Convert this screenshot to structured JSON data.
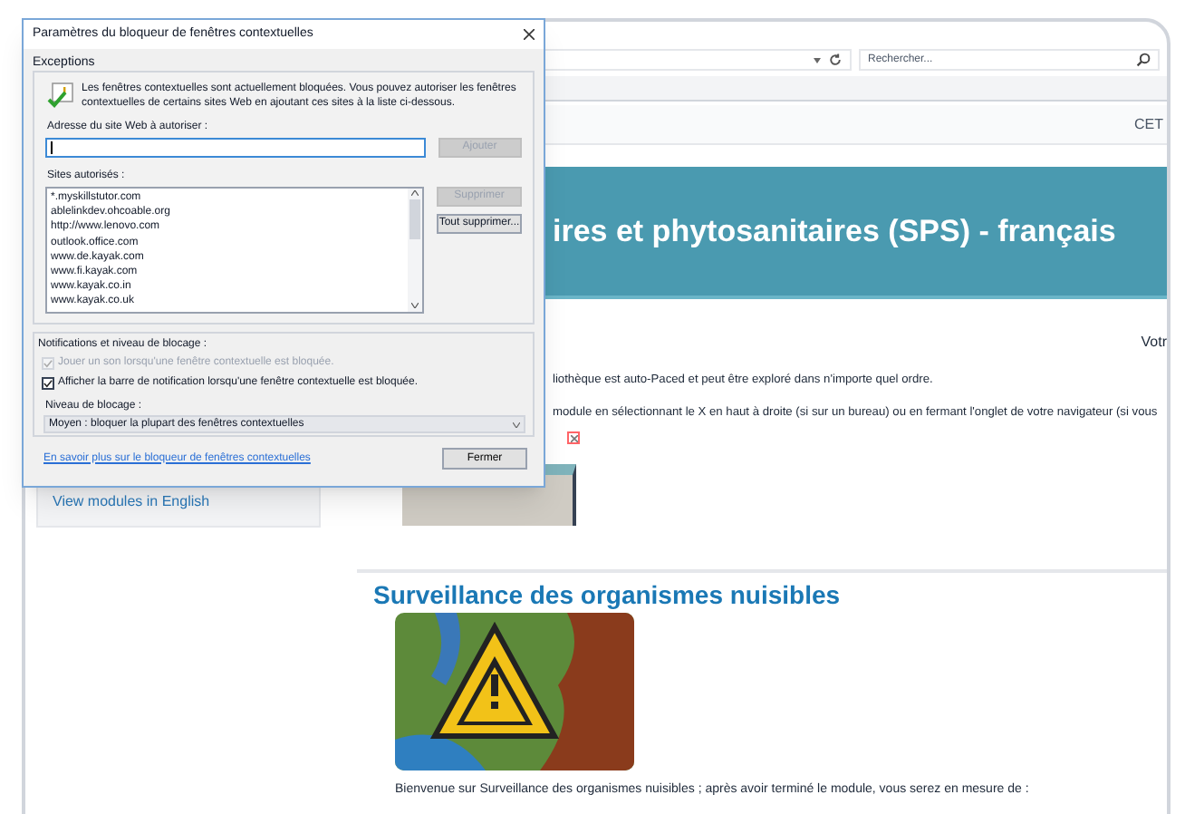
{
  "browser": {
    "search": {
      "placeholder": "Rechercher..."
    },
    "nav_text": "CET",
    "banner_title": "ires et phytosanitaires (SPS) - français",
    "side_text": "Votr",
    "paragraphs": [
      "liothèque est auto-Paced et peut être exploré dans n'importe quel ordre.",
      "module en sélectionnant le X en haut à droite (si sur un bureau) ou en fermant l'onglet de votre navigateur (si vous"
    ],
    "sidebar_link": "View modules in English",
    "section": {
      "heading": "Surveillance des organismes nuisibles",
      "intro": "Bienvenue sur Surveillance des organismes nuisibles ; après avoir terminé le module, vous serez en mesure de :"
    }
  },
  "dialog": {
    "title": "Paramètres du bloqueur de fenêtres contextuelles",
    "exceptions": {
      "heading": "Exceptions",
      "info": "Les fenêtres contextuelles sont actuellement bloquées.  Vous pouvez autoriser les fenêtres contextuelles de certains sites Web en ajoutant ces sites à la liste ci-dessous.",
      "address_label": "Adresse du site Web à autoriser :",
      "add_button": {
        "label": "Ajouter",
        "disabled": true
      },
      "sites_label": "Sites autorisés :",
      "sites": [
        "*.myskillstutor.com",
        "ablelinkdev.ohcoable.org",
        "http://www.lenovo.com",
        "outlook.office.com",
        "www.de.kayak.com",
        "www.fi.kayak.com",
        "www.kayak.co.in",
        "www.kayak.co.uk"
      ],
      "remove_button": {
        "label": "Supprimer",
        "disabled": true
      },
      "remove_all_button": {
        "label": "Tout supprimer...",
        "disabled": false
      }
    },
    "notifications": {
      "heading": "Notifications et niveau de blocage :",
      "options": [
        {
          "label": "Jouer un son lorsqu'une fenêtre contextuelle est bloquée.",
          "checked": true,
          "disabled": true
        },
        {
          "label": "Afficher la barre de notification lorsqu'une fenêtre contextuelle est bloquée.",
          "checked": true,
          "disabled": false
        }
      ],
      "level_label": "Niveau de blocage :",
      "level_value": "Moyen : bloquer la plupart des fenêtres contextuelles"
    },
    "link": "En savoir plus sur le bloqueur de fenêtres contextuelles",
    "close_button": "Fermer"
  }
}
